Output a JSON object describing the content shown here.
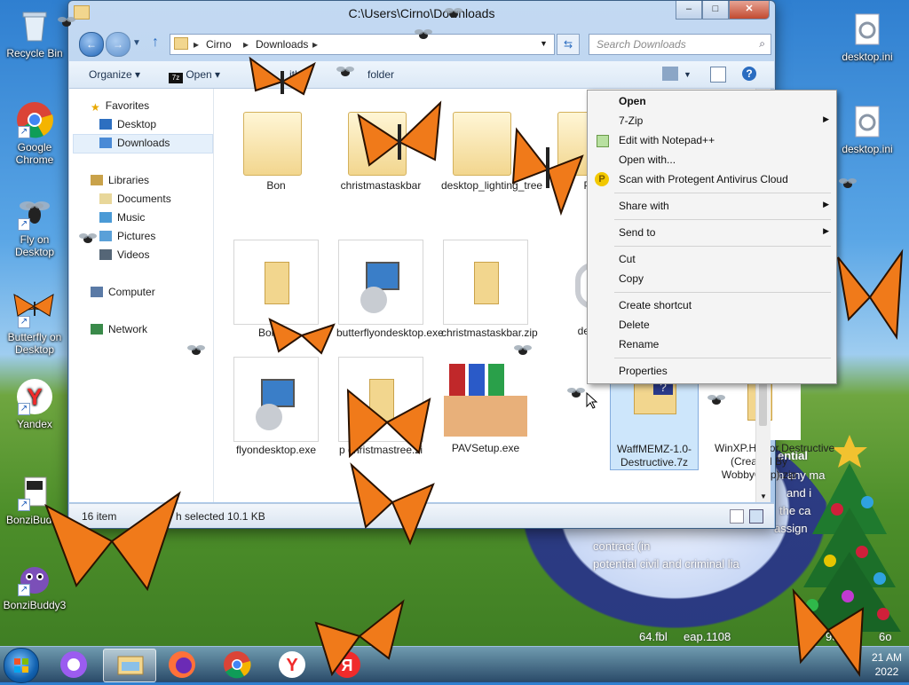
{
  "desktop": {
    "icons_left": [
      {
        "label": "Recycle Bin"
      },
      {
        "label": "Google Chrome"
      },
      {
        "label": "Fly on Desktop"
      },
      {
        "label": "Butterfly on Desktop"
      },
      {
        "label": "Yandex"
      },
      {
        "label": "BonziBuddy"
      },
      {
        "label": "BonziBuddy3"
      }
    ],
    "icons_right": [
      {
        "label": "desktop.ini"
      },
      {
        "label": "desktop.ini"
      }
    ],
    "wallpaper_text": [
      "ential",
      "n any ma",
      "and i",
      "the ca",
      "assign",
      "contract (in",
      "potential civil and criminal lia",
      "64.fbl",
      "eap.1108",
      "95",
      "6o"
    ]
  },
  "window": {
    "title": "C:\\Users\\Cirno\\Downloads",
    "address": {
      "crumb1": "Cirno",
      "crumb2": "Downloads"
    },
    "search_placeholder": "Search Downloads",
    "toolbar": {
      "organize": "Organize",
      "open": "Open",
      "share_with": "ith",
      "new_folder": "folder"
    },
    "nav": {
      "favorites": "Favorites",
      "desktop": "Desktop",
      "downloads": "Downloads",
      "libraries": "Libraries",
      "documents": "Documents",
      "music": "Music",
      "pictures": "Pictures",
      "videos": "Videos",
      "computer": "Computer",
      "network": "Network"
    },
    "files": [
      {
        "name": "Bon",
        "kind": "folder"
      },
      {
        "name": "christmastaskbar",
        "kind": "folder"
      },
      {
        "name": "desktop_lighting_tree",
        "kind": "folder"
      },
      {
        "name": "PA",
        "kind": "folder"
      },
      {
        "name": "Bon.zip",
        "kind": "zip"
      },
      {
        "name": "butterflyondesktop.exe",
        "kind": "installer"
      },
      {
        "name": "christmastaskbar.zip",
        "kind": "zip"
      },
      {
        "name": "deskt",
        "kind": "gear"
      },
      {
        "name": "flyondesktop.exe",
        "kind": "installer"
      },
      {
        "name": "p christmastree.zi",
        "kind": "zip"
      },
      {
        "name": "PAVSetup.exe",
        "kind": "box"
      },
      {
        "name": "WaffMEMZ-1.0-Destructive.7z",
        "kind": "7z"
      },
      {
        "name": "WinXP.Horror.Destructive (Created By WobbyChip).zip",
        "kind": "zip"
      }
    ],
    "status": {
      "count": "16 item",
      "selected": "h selected  10.1 KB"
    }
  },
  "context_menu": {
    "items": [
      {
        "label": "Open",
        "bold": true
      },
      {
        "label": "7-Zip",
        "submenu": true
      },
      {
        "label": "Edit with Notepad++",
        "icon": "notepad-icon"
      },
      {
        "label": "Open with..."
      },
      {
        "label": "Scan with Protegent Antivirus Cloud",
        "icon": "protegent-icon"
      },
      {
        "label": "Share with",
        "submenu": true
      },
      {
        "label": "Send to",
        "submenu": true
      },
      {
        "label": "Cut"
      },
      {
        "label": "Copy"
      },
      {
        "label": "Create shortcut"
      },
      {
        "label": "Delete"
      },
      {
        "label": "Rename"
      },
      {
        "label": "Properties"
      }
    ]
  },
  "taskbar": {
    "clock_time": "21 AM",
    "clock_date": "2022"
  },
  "colors": {
    "accent": "#1f64b6",
    "butterfly": "#f07a1a"
  }
}
